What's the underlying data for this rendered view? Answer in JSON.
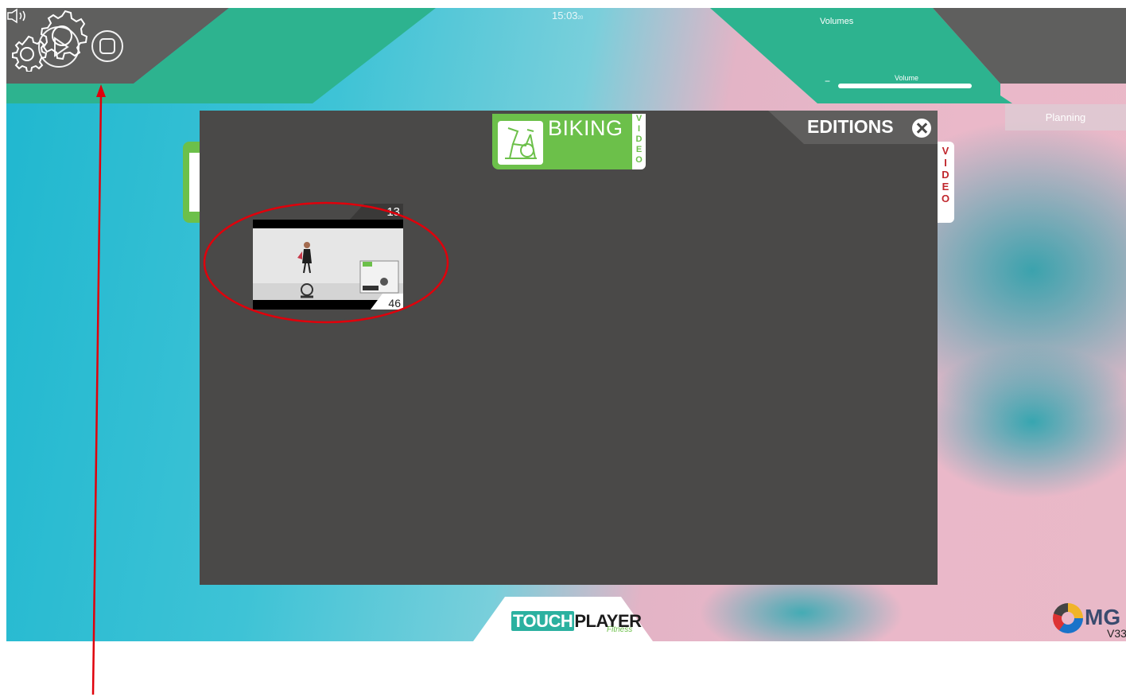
{
  "topbar": {
    "clock": "15:03",
    "clock_seconds": "20",
    "volumes_label": "Volumes",
    "volume_caption": "Volume",
    "volume_minus": "−",
    "volume_level": 1.0,
    "planning_label": "Planning"
  },
  "icons": {
    "play": "play-icon",
    "stop": "stop-icon",
    "speaker": "speaker-icon",
    "settings": "gears-icon",
    "close": "close-icon",
    "bike": "stationary-bike-icon"
  },
  "panel": {
    "title": "EDITIONS",
    "category": {
      "label": "BIKING",
      "video_letters": [
        "V",
        "I",
        "D",
        "E",
        "O"
      ]
    },
    "edition": {
      "top_number": "13",
      "bottom_number": "46"
    }
  },
  "background_cards": {
    "right_video_letters": [
      "V",
      "I",
      "D",
      "E",
      "O"
    ]
  },
  "footer": {
    "logo_touch": "TOUCH",
    "logo_player": "PLAYER",
    "logo_fitness": "Fitness",
    "brand": "MG",
    "version": "V33"
  },
  "colors": {
    "teal_band": "#2db38f",
    "grey_band": "#5f5f5e",
    "panel": "#4a4948",
    "category_green": "#6cc04a",
    "annotation_red": "#e0000b"
  }
}
